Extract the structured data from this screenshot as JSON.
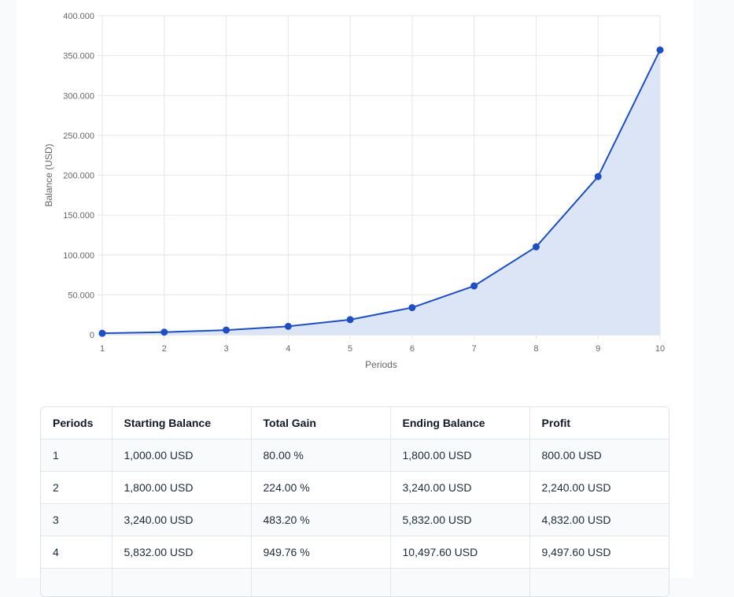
{
  "chart_data": {
    "type": "line",
    "x": [
      1,
      2,
      3,
      4,
      5,
      6,
      7,
      8,
      9,
      10
    ],
    "series": [
      {
        "values": [
          1800,
          3240,
          5832,
          10497.6,
          18895.68,
          34012.22,
          61222.0,
          110199.6,
          198359.3,
          357046.7
        ],
        "color": "#1e4fc2",
        "fill": "#dce5f6"
      }
    ],
    "xlabel": "Periods",
    "ylabel": "Balance (USD)",
    "ylim": [
      0,
      400000
    ],
    "yticks": [
      "0",
      "50.000",
      "100.000",
      "150.000",
      "200.000",
      "250.000",
      "300.000",
      "350.000",
      "400.000"
    ],
    "xticks": [
      "1",
      "2",
      "3",
      "4",
      "5",
      "6",
      "7",
      "8",
      "9",
      "10"
    ],
    "grid": true
  },
  "table": {
    "headers": [
      "Periods",
      "Starting Balance",
      "Total Gain",
      "Ending Balance",
      "Profit"
    ],
    "rows": [
      [
        "1",
        "1,000.00 USD",
        "80.00 %",
        "1,800.00 USD",
        "800.00 USD"
      ],
      [
        "2",
        "1,800.00 USD",
        "224.00 %",
        "3,240.00 USD",
        "2,240.00 USD"
      ],
      [
        "3",
        "3,240.00 USD",
        "483.20 %",
        "5,832.00 USD",
        "4,832.00 USD"
      ],
      [
        "4",
        "5,832.00 USD",
        "949.76 %",
        "10,497.60 USD",
        "9,497.60 USD"
      ]
    ]
  }
}
